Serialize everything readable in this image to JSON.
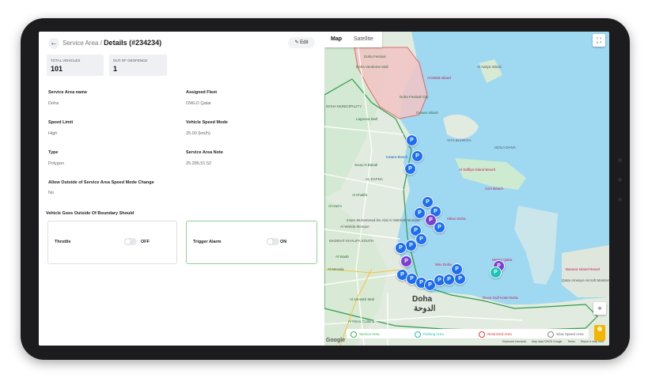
{
  "header": {
    "crumb_parent": "Service Area",
    "crumb_sep": "/",
    "crumb_current": "Details (#234234)",
    "edit_label": "Edit",
    "back_glyph": "←",
    "edit_glyph": "✎"
  },
  "stats": [
    {
      "label": "TOTAL VEHICLES",
      "value": "101"
    },
    {
      "label": "OUT OF GEOFENCE",
      "value": "1"
    }
  ],
  "fields": {
    "service_area_name": {
      "label": "Service Area name",
      "value": "Doha"
    },
    "assigned_fleet": {
      "label": "Assigned Fleet",
      "value": "OWLO Qatar"
    },
    "speed_limit": {
      "label": "Speed Limit",
      "value": "High"
    },
    "vehicle_speed_mode": {
      "label": "Vehicle Speed Mode",
      "value": "25.00 (km/h)"
    },
    "type": {
      "label": "Type",
      "value": "Polygon"
    },
    "service_area_note": {
      "label": "Service Area Note",
      "value": "25.285,51.52"
    },
    "allow_outside": {
      "label": "Allow Outside of Service Area Speed Mode Change",
      "value": "No"
    }
  },
  "boundary": {
    "heading": "Vehicle Goes Outside Of Boundary Should",
    "throttle": {
      "label": "Throttle",
      "state": "OFF"
    },
    "trigger_alarm": {
      "label": "Trigger Alarm",
      "state": "ON"
    }
  },
  "map": {
    "tabs": [
      "Map",
      "Satellite"
    ],
    "fullscreen_icon": "⛶",
    "location_icon": "⌖",
    "google": "Google",
    "city_en": "Doha",
    "city_ar": "الدوحة",
    "labels": [
      {
        "text": "Katara Beach",
        "cls": "blue"
      },
      {
        "text": "Al Mahā Island",
        "cls": "red"
      },
      {
        "text": "Al Aaliya Island",
        "cls": "gray"
      },
      {
        "text": "VIYA BAHRIYA",
        "cls": "gray"
      },
      {
        "text": "ISOLA DANA",
        "cls": "gray"
      },
      {
        "text": "Al Saffiya Island Beach",
        "cls": "red"
      },
      {
        "text": "Azm Beach",
        "cls": "red"
      },
      {
        "text": "Lagoona Mall",
        "cls": ""
      },
      {
        "text": "Gewan Island",
        "cls": ""
      },
      {
        "text": "Doha Festival City",
        "cls": ""
      },
      {
        "text": "Hilton Doha",
        "cls": "red"
      },
      {
        "text": "Al Hazm",
        "cls": ""
      },
      {
        "text": "Al Wahda Mosque",
        "cls": "gray"
      },
      {
        "text": "Mosque",
        "cls": "gray"
      },
      {
        "text": "Al Asmakh Mall",
        "cls": ""
      },
      {
        "text": "Al Mana Galleria",
        "cls": ""
      },
      {
        "text": "Rixos Gulf Hotel Doha",
        "cls": "red"
      },
      {
        "text": "Qatar Airways Aircraft Maintenance Hangar",
        "cls": "gray"
      },
      {
        "text": "Banana Island Resort",
        "cls": "red"
      },
      {
        "text": "DOHA MUNICIPALITY",
        "cls": "gray"
      },
      {
        "text": "AL DAFNA",
        "cls": "gray"
      },
      {
        "text": "Souq Al Baladi",
        "cls": ""
      },
      {
        "text": "Al Khalifa",
        "cls": ""
      },
      {
        "text": "Imam Muhammad ibn Abd Al Wahhab Mosque",
        "cls": "gray"
      },
      {
        "text": "MADINAT KHALIFA SOUTH",
        "cls": "gray"
      },
      {
        "text": "Al Messila",
        "cls": ""
      },
      {
        "text": "Al Waab",
        "cls": ""
      },
      {
        "text": "Miru Doha",
        "cls": "red"
      },
      {
        "text": "Mwani Qatar",
        "cls": "red"
      },
      {
        "text": "Doha Vendome Mall",
        "cls": ""
      },
      {
        "text": "Doha Festival",
        "cls": ""
      }
    ],
    "legend": [
      {
        "label": "Service Area",
        "color": "#3bb45a"
      },
      {
        "label": "Parking Area",
        "color": "#26bfb3"
      },
      {
        "label": "Restricted Area",
        "color": "#e53935"
      },
      {
        "label": "Slow Speed Area",
        "color": "#888888"
      }
    ],
    "attribution": [
      "Keyboard shortcuts",
      "Map data ©2025 Google",
      "Terms",
      "Report a map error"
    ],
    "pin_glyph": "P"
  }
}
